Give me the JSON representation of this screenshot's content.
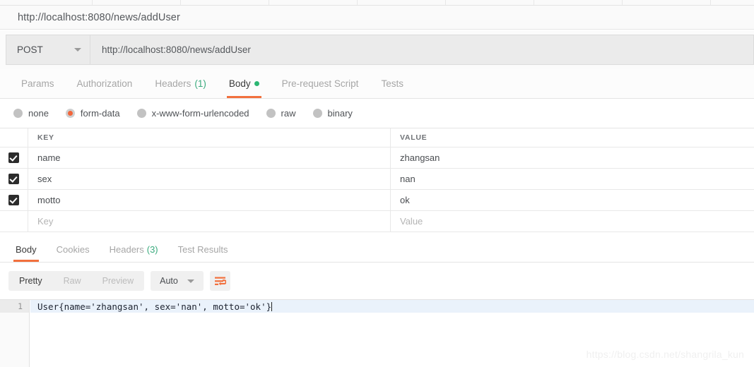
{
  "window": {
    "request_title": "http://localhost:8080/news/addUser",
    "tab_dividers": [
      130,
      255,
      380,
      505,
      630,
      755,
      880,
      1005
    ]
  },
  "url_bar": {
    "method": "POST",
    "method_caret": "chevron-down-icon",
    "url": "http://localhost:8080/news/addUser"
  },
  "request_tabs": [
    {
      "label": "Params",
      "active": false,
      "count": "",
      "dot": false
    },
    {
      "label": "Authorization",
      "active": false,
      "count": "",
      "dot": false
    },
    {
      "label": "Headers",
      "active": false,
      "count": "(1)",
      "dot": false
    },
    {
      "label": "Body",
      "active": true,
      "count": "",
      "dot": true
    },
    {
      "label": "Pre-request Script",
      "active": false,
      "count": "",
      "dot": false
    },
    {
      "label": "Tests",
      "active": false,
      "count": "",
      "dot": false
    }
  ],
  "body_types": [
    {
      "label": "none",
      "selected": false
    },
    {
      "label": "form-data",
      "selected": true
    },
    {
      "label": "x-www-form-urlencoded",
      "selected": false
    },
    {
      "label": "raw",
      "selected": false
    },
    {
      "label": "binary",
      "selected": false
    }
  ],
  "form_table": {
    "columns": [
      "KEY",
      "VALUE"
    ],
    "rows": [
      {
        "checked": true,
        "key": "name",
        "value": "zhangsan",
        "placeholder": false
      },
      {
        "checked": true,
        "key": "sex",
        "value": "nan",
        "placeholder": false
      },
      {
        "checked": true,
        "key": "motto",
        "value": "ok",
        "placeholder": false
      },
      {
        "checked": false,
        "key": "Key",
        "value": "Value",
        "placeholder": true
      }
    ]
  },
  "response_tabs": [
    {
      "label": "Body",
      "active": true,
      "count": ""
    },
    {
      "label": "Cookies",
      "active": false,
      "count": ""
    },
    {
      "label": "Headers",
      "active": false,
      "count": "(3)"
    },
    {
      "label": "Test Results",
      "active": false,
      "count": ""
    }
  ],
  "response_toolbar": {
    "view_modes": [
      {
        "label": "Pretty",
        "active": true
      },
      {
        "label": "Raw",
        "active": false
      },
      {
        "label": "Preview",
        "active": false
      }
    ],
    "format_select": {
      "value": "Auto",
      "caret": "chevron-down-icon"
    },
    "wrap_button": {
      "icon": "word-wrap-icon",
      "color": "#f2703d"
    }
  },
  "response_body": {
    "line_number": "1",
    "text": "User{name='zhangsan', sex='nan', motto='ok'}"
  },
  "watermark": "https://blog.csdn.net/shangrila_kun",
  "colors": {
    "accent": "#f2703d",
    "green": "#2cb673",
    "count_green": "#3bab7e",
    "radio_selected": "#f2653a",
    "checkbox": "#2c2c2c",
    "active_line": "#eaf2fb"
  }
}
